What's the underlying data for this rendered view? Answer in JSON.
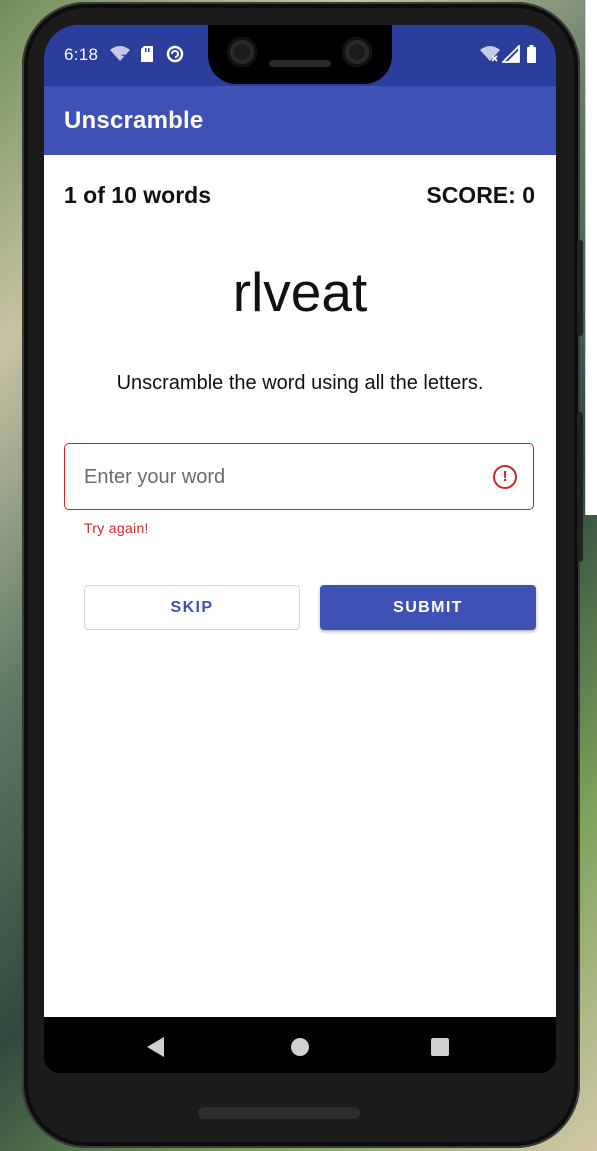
{
  "status_bar": {
    "time": "6:18",
    "icons": [
      "wifi-question-icon",
      "sd-card-icon",
      "sync-icon",
      "wifi-off-icon",
      "cellular-signal-icon",
      "battery-icon"
    ]
  },
  "app_bar": {
    "title": "Unscramble"
  },
  "game": {
    "word_count": "1 of 10 words",
    "score": "SCORE: 0",
    "scrambled_word": "rlveat",
    "instructions": "Unscramble the word using all the letters."
  },
  "input": {
    "placeholder": "Enter your word",
    "value": "",
    "error_text": "Try again!",
    "error_icon": "!"
  },
  "buttons": {
    "skip": "SKIP",
    "submit": "SUBMIT"
  },
  "colors": {
    "primary": "#3f51b5",
    "primary_dark": "#2c3e9c",
    "error": "#c62828"
  }
}
